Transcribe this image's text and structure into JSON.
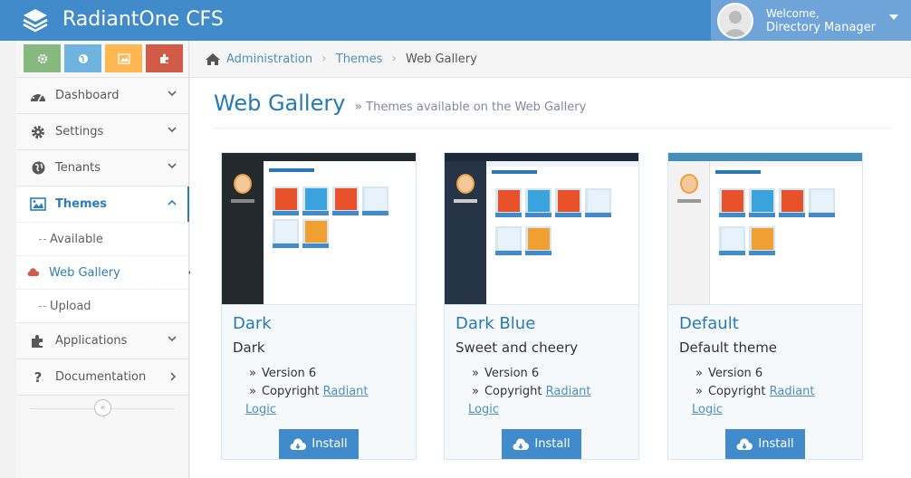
{
  "app": {
    "title": "RadiantOne CFS"
  },
  "user": {
    "welcome": "Welcome,",
    "name": "Directory Manager"
  },
  "shortcuts": [
    {
      "icon": "gear-icon",
      "color": "#87b87f"
    },
    {
      "icon": "globe-icon",
      "color": "#6fb3e0"
    },
    {
      "icon": "picture-icon",
      "color": "#ffb752"
    },
    {
      "icon": "puzzle-icon",
      "color": "#d15b47"
    }
  ],
  "sidebar": {
    "items": [
      {
        "label": "Dashboard",
        "icon": "dashboard-icon"
      },
      {
        "label": "Settings",
        "icon": "gear-icon"
      },
      {
        "label": "Tenants",
        "icon": "globe-icon"
      },
      {
        "label": "Themes",
        "icon": "picture-icon"
      },
      {
        "label": "Applications",
        "icon": "puzzle-icon"
      },
      {
        "label": "Documentation",
        "icon": "question-icon"
      }
    ],
    "themes_sub": [
      {
        "label": "Available"
      },
      {
        "label": "Web Gallery"
      },
      {
        "label": "Upload"
      }
    ]
  },
  "breadcrumb": {
    "home": "home-icon",
    "items": [
      "Administration",
      "Themes"
    ],
    "current": "Web Gallery"
  },
  "page": {
    "title": "Web Gallery",
    "subtitle": "Themes available on the Web Gallery"
  },
  "themes": [
    {
      "name": "Dark",
      "description": "Dark",
      "version": "Version 6",
      "copyright_prefix": "Copyright ",
      "copyright_link": "Radiant",
      "copyright_link2": "Logic",
      "install": "Install"
    },
    {
      "name": "Dark Blue",
      "description": "Sweet and cheery",
      "version": "Version 6",
      "copyright_prefix": "Copyright ",
      "copyright_link": "Radiant",
      "copyright_link2": "Logic",
      "install": "Install"
    },
    {
      "name": "Default",
      "description": "Default theme",
      "version": "Version 6",
      "copyright_prefix": "Copyright ",
      "copyright_link": "Radiant",
      "copyright_link2": "Logic",
      "install": "Install"
    }
  ],
  "colors": {
    "brand": "#428bca",
    "accent": "#2679b5",
    "link": "#4c8fbd"
  }
}
